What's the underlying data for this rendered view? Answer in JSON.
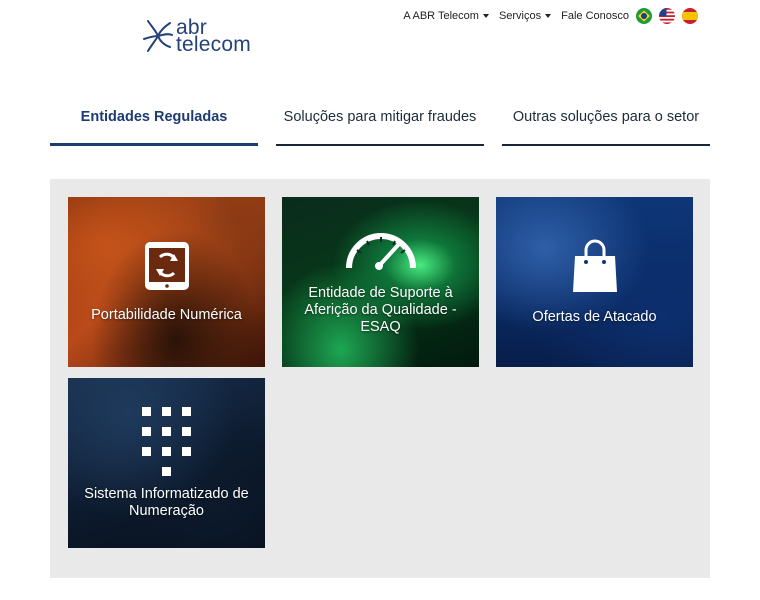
{
  "logo": {
    "line1": "abr",
    "line2": "telecom"
  },
  "topnav": {
    "items": [
      {
        "label": "A ABR Telecom",
        "has_caret": true
      },
      {
        "label": "Serviços",
        "has_caret": true
      },
      {
        "label": "Fale Conosco",
        "has_caret": false
      }
    ],
    "flags": [
      "brazil-flag-icon",
      "usa-flag-icon",
      "spain-flag-icon"
    ]
  },
  "tabs": [
    {
      "label": "Entidades Reguladas",
      "active": true
    },
    {
      "label": "Soluções para mitigar fraudes",
      "active": false
    },
    {
      "label": "Outras soluções para o setor",
      "active": false
    }
  ],
  "cards": [
    {
      "label": "Portabilidade Numérica",
      "icon": "phone-swap-icon"
    },
    {
      "label": "Entidade de Suporte à Aferição da Qualidade - ESAQ",
      "icon": "speedometer-icon"
    },
    {
      "label": "Ofertas de Atacado",
      "icon": "shopping-bag-icon"
    },
    {
      "label": "Sistema Informatizado de Numeração",
      "icon": "keypad-icon"
    }
  ],
  "colors": {
    "brand": "#24427a",
    "active_tab": "#1f3b73",
    "panel_bg": "#e9e9e9"
  }
}
